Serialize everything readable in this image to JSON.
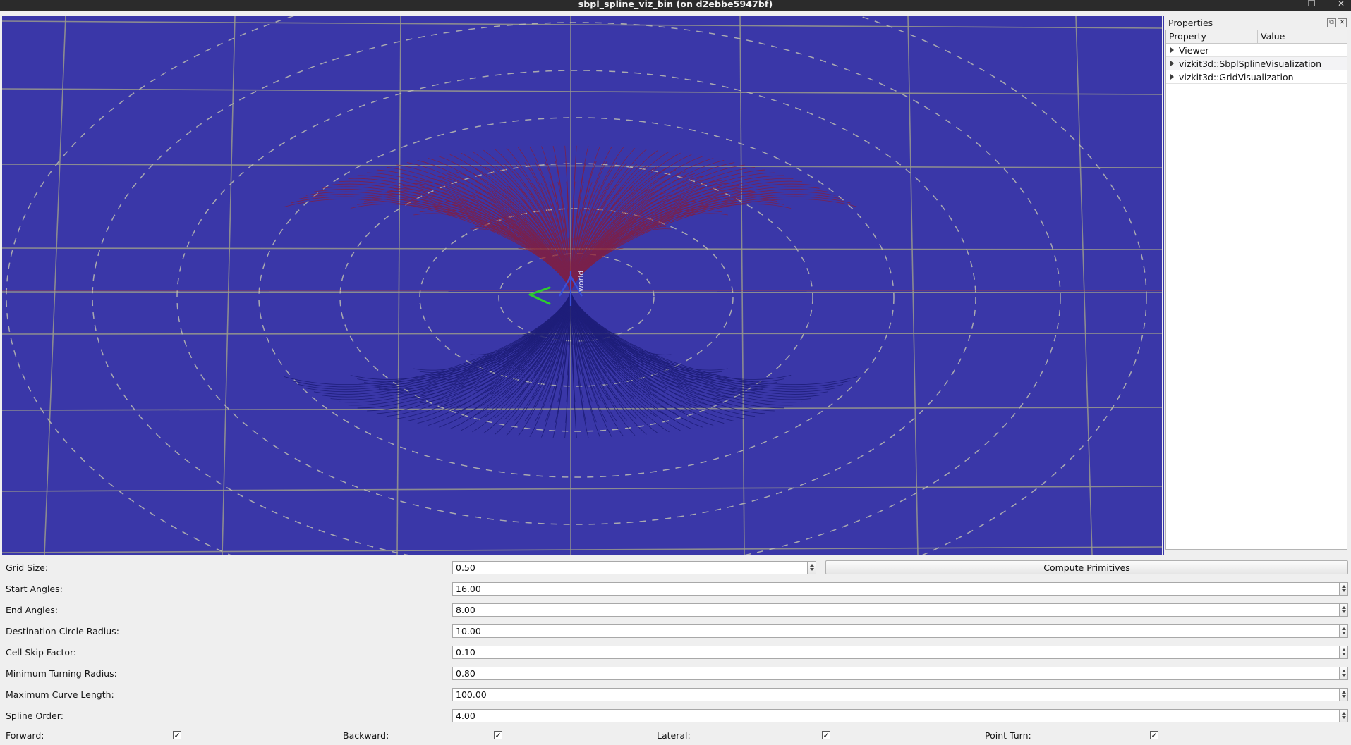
{
  "window": {
    "title": "sbpl_spline_viz_bin (on d2ebbe5947bf)",
    "minimize_label": "—",
    "maximize_label": "❐",
    "close_label": "✕"
  },
  "properties_dock": {
    "title": "Properties",
    "float_icon_label": "⧉",
    "close_icon_label": "✕",
    "columns": [
      "Property",
      "Value"
    ],
    "rows": [
      {
        "name": "Viewer",
        "value": ""
      },
      {
        "name": "vizkit3d::SbplSplineVisualization",
        "value": ""
      },
      {
        "name": "vizkit3d::GridVisualization",
        "value": ""
      }
    ]
  },
  "viewport": {
    "background_color": "#3a37a8",
    "grid_line_color": "#9a9a8c",
    "dashed_circle_color": "#b9b9ae",
    "forward_fan_color": "#8b1a2b",
    "backward_fan_color": "#1b1b6e",
    "origin_label": "world",
    "axis_x_color": "#c03030",
    "axis_y_color": "#30b030",
    "axis_z_color": "#3050d0",
    "robot_marker_color": "#22cc22"
  },
  "form": {
    "rows": [
      {
        "label": "Grid Size:",
        "value": "0.50"
      },
      {
        "label": "Start Angles:",
        "value": "16.00"
      },
      {
        "label": "End Angles:",
        "value": "8.00"
      },
      {
        "label": "Destination Circle Radius:",
        "value": "10.00"
      },
      {
        "label": "Cell Skip Factor:",
        "value": "0.10"
      },
      {
        "label": "Minimum Turning Radius:",
        "value": "0.80"
      },
      {
        "label": "Maximum Curve Length:",
        "value": "100.00"
      },
      {
        "label": "Spline Order:",
        "value": "4.00"
      }
    ],
    "compute_button": "Compute Primitives",
    "checkboxes": [
      {
        "label": "Forward:",
        "checked": true,
        "mark": "✓"
      },
      {
        "label": "Backward:",
        "checked": true,
        "mark": "✓"
      },
      {
        "label": "Lateral:",
        "checked": true,
        "mark": "✓"
      },
      {
        "label": "Point Turn:",
        "checked": true,
        "mark": "✓"
      }
    ]
  }
}
